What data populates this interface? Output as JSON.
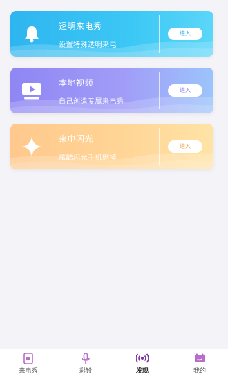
{
  "cards": [
    {
      "title": "透明来电秀",
      "subtitle": "设置特殊透明来电",
      "button": "进入",
      "icon": "bell-icon"
    },
    {
      "title": "本地视频",
      "subtitle": "自己创造专属来电秀",
      "button": "进入",
      "icon": "video-play-icon"
    },
    {
      "title": "来电闪光",
      "subtitle": "炫酷闪光手机删掉",
      "button": "进入",
      "icon": "sparkle-icon"
    }
  ],
  "tabs": [
    {
      "label": "来电秀",
      "icon": "phone-icon"
    },
    {
      "label": "彩铃",
      "icon": "microphone-icon"
    },
    {
      "label": "发现",
      "icon": "broadcast-icon"
    },
    {
      "label": "我的",
      "icon": "smile-bag-icon"
    }
  ],
  "colors": {
    "card1": "#2eb5f0",
    "card2": "#8f86f4",
    "card3": "#ffc88d",
    "tab_icon": "#b86dc8"
  }
}
